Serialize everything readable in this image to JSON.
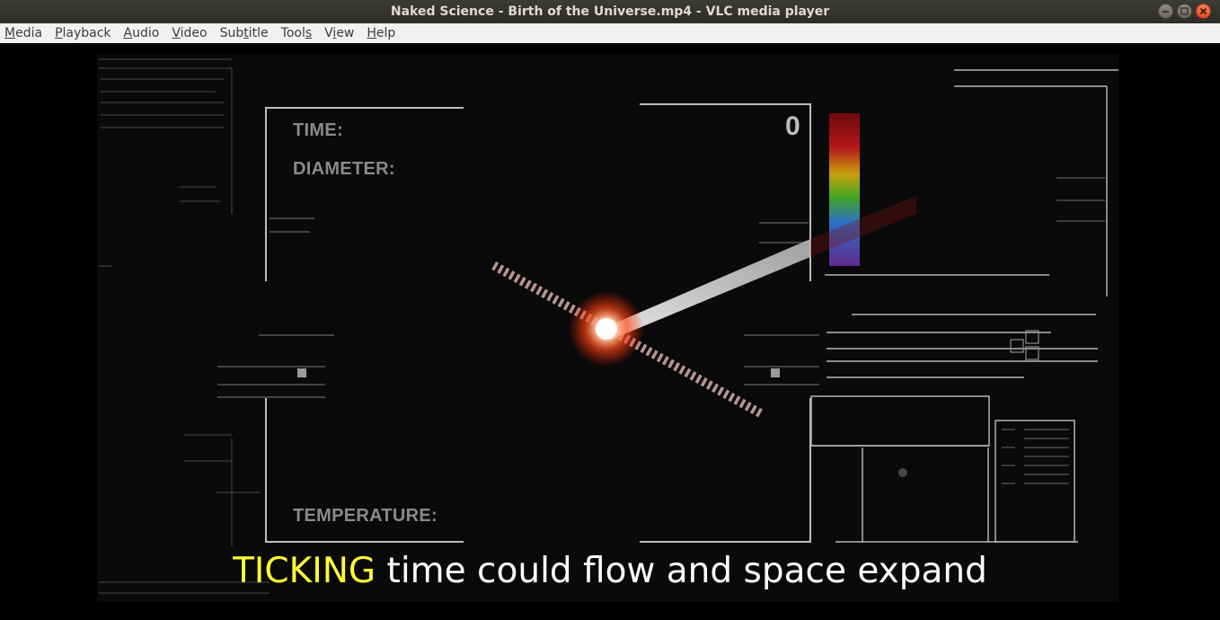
{
  "window": {
    "title": "Naked Science - Birth of the Universe.mp4 - VLC media player"
  },
  "menu": [
    {
      "label": "Media",
      "accel": "M"
    },
    {
      "label": "Playback",
      "accel": "P"
    },
    {
      "label": "Audio",
      "accel": "A"
    },
    {
      "label": "Video",
      "accel": "V"
    },
    {
      "label": "Subtitle",
      "accel": "t"
    },
    {
      "label": "Tools",
      "accel": "s"
    },
    {
      "label": "View",
      "accel": "i"
    },
    {
      "label": "Help",
      "accel": "H"
    }
  ],
  "video": {
    "hud": {
      "time_label": "TIME:",
      "diameter_label": "DIAMETER:",
      "temperature_label": "TEMPERATURE:",
      "counter": "0"
    },
    "subtitle": {
      "highlight": "TICKING",
      "rest": " time could flow and space expand"
    }
  },
  "colors": {
    "titlebar": "#3c3b37",
    "menubar": "#f2f1f0",
    "subtitle_highlight": "#ffff33",
    "subtitle_text": "#ffffff",
    "close_button": "#df4a1d"
  },
  "icons": {
    "minimize": "minimize-icon",
    "maximize": "maximize-icon",
    "close": "close-icon"
  }
}
